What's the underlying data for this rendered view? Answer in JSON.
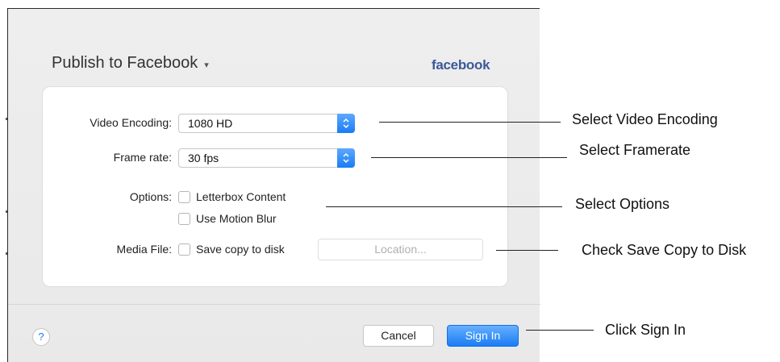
{
  "dialog": {
    "title": "Publish to Facebook",
    "title_caret": "▾",
    "brand": "facebook",
    "fields": {
      "video_encoding": {
        "label": "Video Encoding:",
        "value": "1080 HD"
      },
      "frame_rate": {
        "label": "Frame rate:",
        "value": "30 fps"
      },
      "options": {
        "label": "Options:",
        "letterbox": "Letterbox Content",
        "motion_blur": "Use Motion Blur"
      },
      "media_file": {
        "label": "Media File:",
        "save_copy": "Save copy to disk",
        "location_placeholder": "Location..."
      }
    },
    "footer": {
      "help": "?",
      "cancel": "Cancel",
      "sign_in": "Sign In"
    }
  },
  "callouts": {
    "video_encoding": "Select Video Encoding",
    "frame_rate": "Select Framerate",
    "options": "Select Options",
    "save_copy": "Check Save Copy to Disk",
    "sign_in": "Click Sign In"
  },
  "icons": {
    "stepper": "up-down-chevron-icon",
    "help": "question-mark-icon",
    "title_caret": "chevron-down-icon"
  },
  "colors": {
    "accent": "#1a7cf5",
    "brand": "#3b5998",
    "dialog_bg": "#eeeeee"
  }
}
